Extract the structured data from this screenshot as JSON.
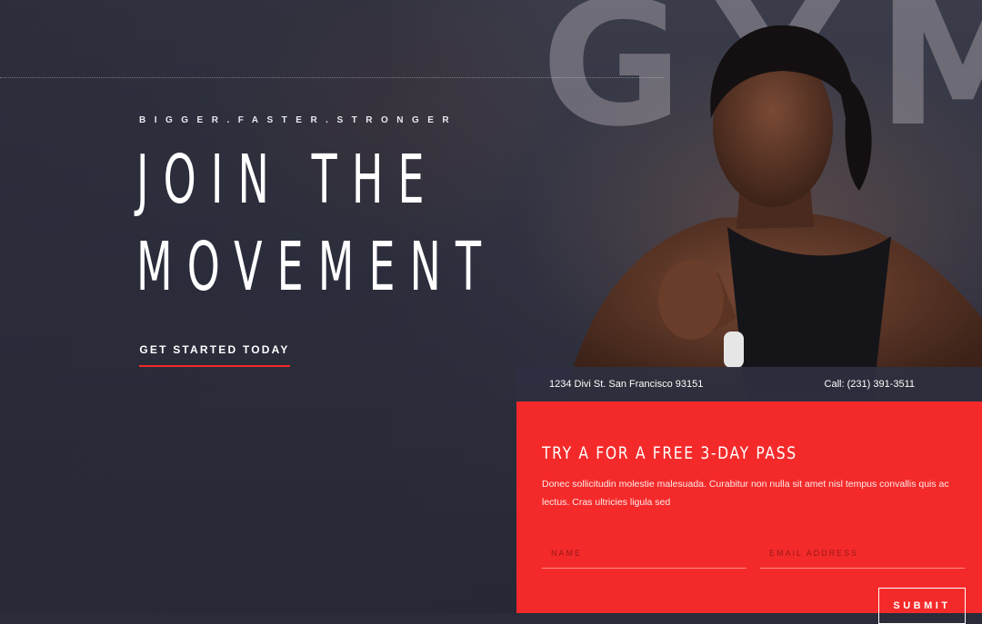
{
  "hero": {
    "background_word": "GYM",
    "tagline": "BIGGER.FASTER.STRONGER",
    "headline_line1": "JOIN THE",
    "headline_line2": "MOVEMENT",
    "cta_label": "GET STARTED TODAY"
  },
  "info_bar": {
    "address": "1234 Divi St. San Francisco 93151",
    "phone": "Call: (231) 391-3511"
  },
  "signup_form": {
    "title": "TRY A FOR A FREE 3-DAY PASS",
    "description": "Donec sollicitudin molestie malesuada. Curabitur non nulla sit amet nisl tempus convallis quis ac lectus. Cras ultricies ligula sed",
    "name_placeholder": "NAME",
    "email_placeholder": "EMAIL ADDRESS",
    "submit_label": "SUBMIT"
  },
  "colors": {
    "accent": "#f42a2a",
    "hero_overlay": "#2a2c3a",
    "info_bar": "#2e3040"
  }
}
